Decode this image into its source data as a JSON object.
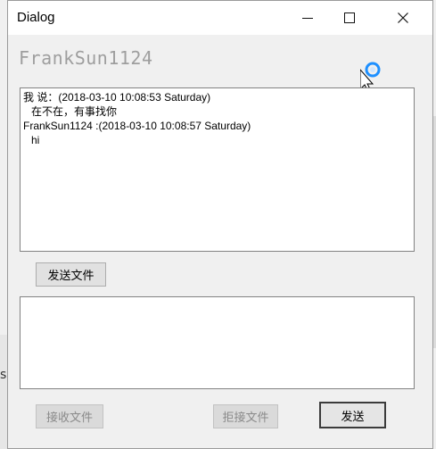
{
  "window": {
    "title": "Dialog"
  },
  "background": {
    "left_text": "s.",
    "right_text": "く"
  },
  "peer": {
    "name": "FrankSun1124"
  },
  "history": {
    "messages": [
      {
        "header": "我 说：(2018-03-10 10:08:53 Saturday)",
        "body": "在不在，有事找你"
      },
      {
        "header": "FrankSun1124 :(2018-03-10 10:08:57 Saturday)",
        "body": "hi"
      }
    ]
  },
  "buttons": {
    "send_file": "发送文件",
    "accept_file": "接收文件",
    "reject_file": "拒接文件",
    "send": "发送"
  },
  "input": {
    "value": ""
  },
  "colors": {
    "busy_indicator": "#1e90ff"
  },
  "icons": {
    "cursor": "cursor-busy-icon"
  }
}
